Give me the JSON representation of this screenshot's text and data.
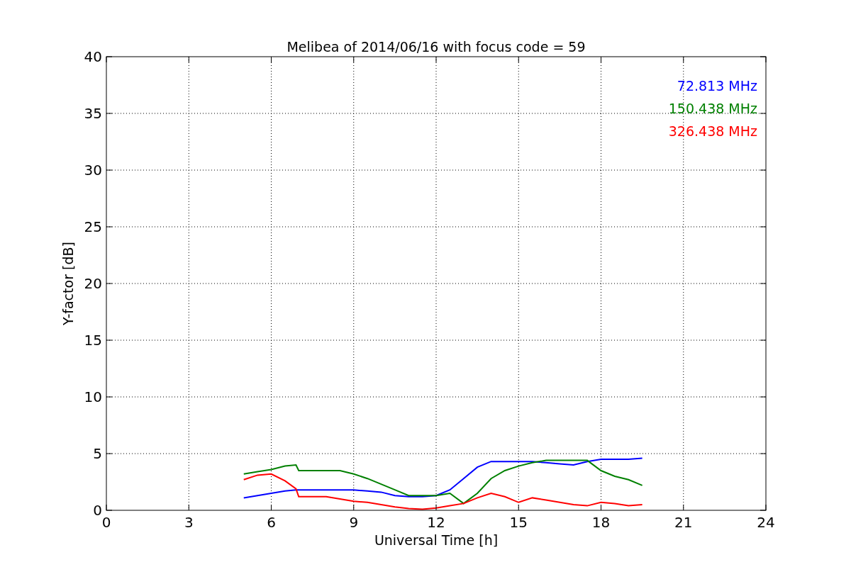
{
  "chart_data": {
    "type": "line",
    "title": "Melibea of 2014/06/16 with focus code = 59",
    "xlabel": "Universal Time [h]",
    "ylabel": "Y-factor [dB]",
    "x": [
      5,
      5.5,
      6,
      6.5,
      6.9,
      7,
      8,
      8.5,
      9,
      9.5,
      10,
      10.5,
      11,
      11.5,
      12,
      12.5,
      13,
      13.5,
      14,
      14.5,
      15,
      15.5,
      16,
      16.5,
      17,
      17.5,
      18,
      18.5,
      19,
      19.5
    ],
    "series": [
      {
        "name": "72.813 MHz",
        "color": "#0000ff",
        "values": [
          1.1,
          1.3,
          1.5,
          1.7,
          1.8,
          1.8,
          1.8,
          1.8,
          1.8,
          1.7,
          1.6,
          1.3,
          1.2,
          1.2,
          1.3,
          1.8,
          2.8,
          3.8,
          4.3,
          4.3,
          4.3,
          4.3,
          4.2,
          4.1,
          4.0,
          4.3,
          4.5,
          4.5,
          4.5,
          4.6
        ]
      },
      {
        "name": "150.438 MHz",
        "color": "#008000",
        "values": [
          3.2,
          3.4,
          3.6,
          3.9,
          4.0,
          3.5,
          3.5,
          3.5,
          3.2,
          2.8,
          2.3,
          1.8,
          1.3,
          1.3,
          1.3,
          1.5,
          0.6,
          1.5,
          2.8,
          3.5,
          3.9,
          4.2,
          4.4,
          4.4,
          4.4,
          4.4,
          3.5,
          3.0,
          2.7,
          2.2
        ]
      },
      {
        "name": "326.438 MHz",
        "color": "#ff0000",
        "values": [
          2.7,
          3.1,
          3.2,
          2.6,
          1.9,
          1.2,
          1.2,
          1.0,
          0.8,
          0.7,
          0.5,
          0.3,
          0.15,
          0.1,
          0.2,
          0.4,
          0.6,
          1.1,
          1.5,
          1.2,
          0.7,
          1.1,
          0.9,
          0.7,
          0.5,
          0.4,
          0.7,
          0.6,
          0.4,
          0.5
        ]
      }
    ],
    "xlim": [
      0,
      24
    ],
    "ylim": [
      0,
      40
    ],
    "xticks": [
      0,
      3,
      6,
      9,
      12,
      15,
      18,
      21,
      24
    ],
    "yticks": [
      0,
      5,
      10,
      15,
      20,
      25,
      30,
      35,
      40
    ],
    "grid": true
  }
}
